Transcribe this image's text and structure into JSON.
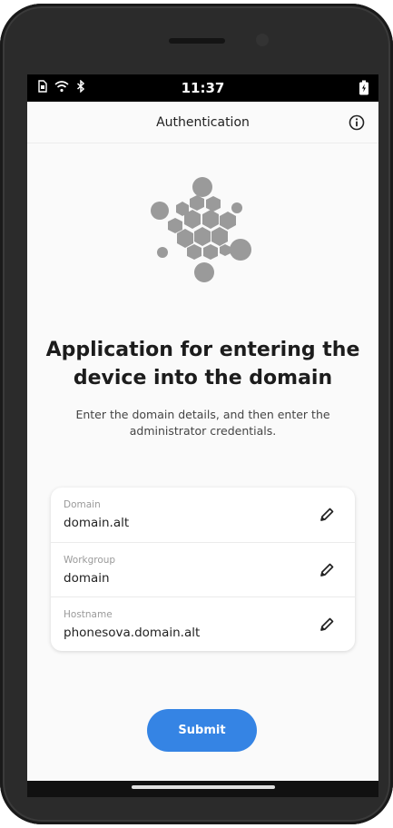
{
  "status_bar": {
    "time": "11:37",
    "icons": [
      "sim-icon",
      "wifi-icon",
      "bluetooth-icon",
      "battery-charging-icon"
    ]
  },
  "header": {
    "title": "Authentication",
    "info_icon": "info-icon"
  },
  "logo_icon": "domain-hexagon-logo",
  "headline": "Application for entering the device into the domain",
  "subtitle": "Enter the domain details, and then enter the administrator credentials.",
  "fields": [
    {
      "label": "Domain",
      "value": "domain.alt",
      "icon": "pencil-icon"
    },
    {
      "label": "Workgroup",
      "value": "domain",
      "icon": "pencil-icon"
    },
    {
      "label": "Hostname",
      "value": "phonesova.domain.alt",
      "icon": "pencil-icon"
    }
  ],
  "submit_label": "Submit",
  "colors": {
    "accent": "#3584e4",
    "logo_gray": "#9a9a9a",
    "background": "#fafafa"
  }
}
